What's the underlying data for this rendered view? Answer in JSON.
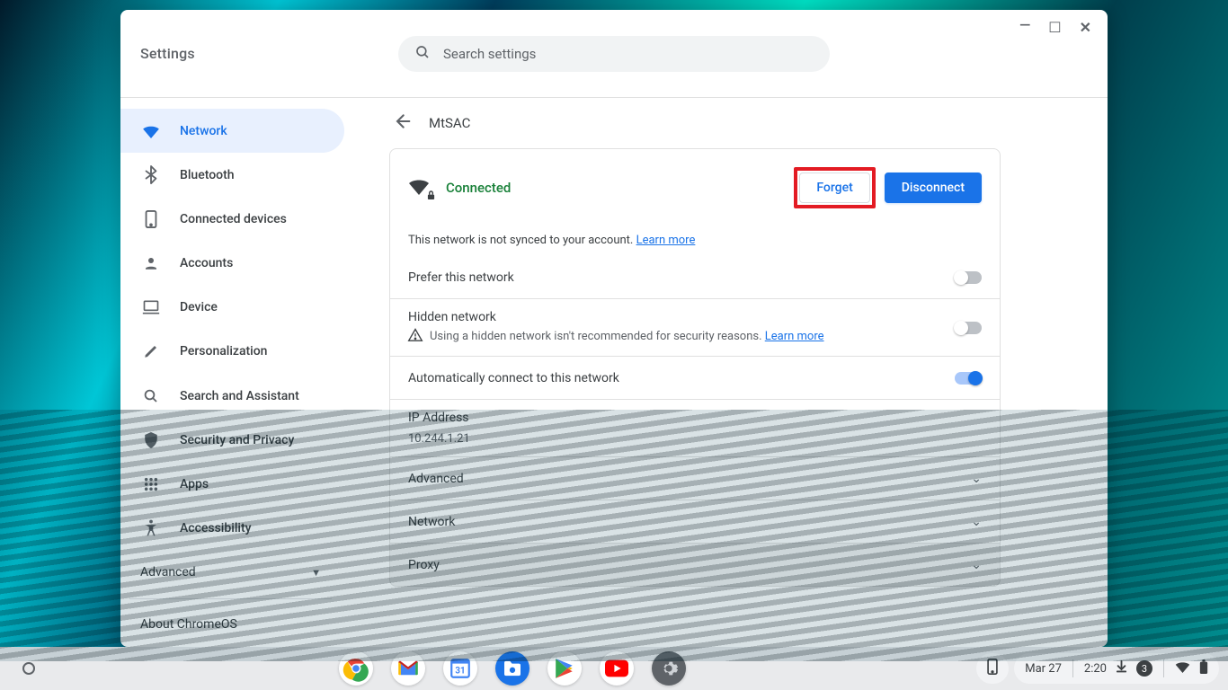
{
  "app_title": "Settings",
  "search": {
    "placeholder": "Search settings"
  },
  "sidebar": {
    "items": [
      {
        "label": "Network"
      },
      {
        "label": "Bluetooth"
      },
      {
        "label": "Connected devices"
      },
      {
        "label": "Accounts"
      },
      {
        "label": "Device"
      },
      {
        "label": "Personalization"
      },
      {
        "label": "Search and Assistant"
      },
      {
        "label": "Security and Privacy"
      },
      {
        "label": "Apps"
      },
      {
        "label": "Accessibility"
      }
    ],
    "advanced": "Advanced",
    "about": "About ChromeOS"
  },
  "detail": {
    "breadcrumb": "MtSAC",
    "status": "Connected",
    "forget": "Forget",
    "disconnect": "Disconnect",
    "sync_note": "This network is not synced to your account. ",
    "sync_learn": "Learn more",
    "rows": {
      "prefer": "Prefer this network",
      "hidden_title": "Hidden network",
      "hidden_sub": "Using a hidden network isn't recommended for security reasons. ",
      "hidden_learn": "Learn more",
      "auto": "Automatically connect to this network",
      "ip_label": "IP Address",
      "ip_value": "10.244.1.21",
      "advanced": "Advanced",
      "network": "Network",
      "proxy": "Proxy"
    }
  },
  "shelf": {
    "date": "Mar 27",
    "time": "2:20",
    "notif_count": "3"
  }
}
